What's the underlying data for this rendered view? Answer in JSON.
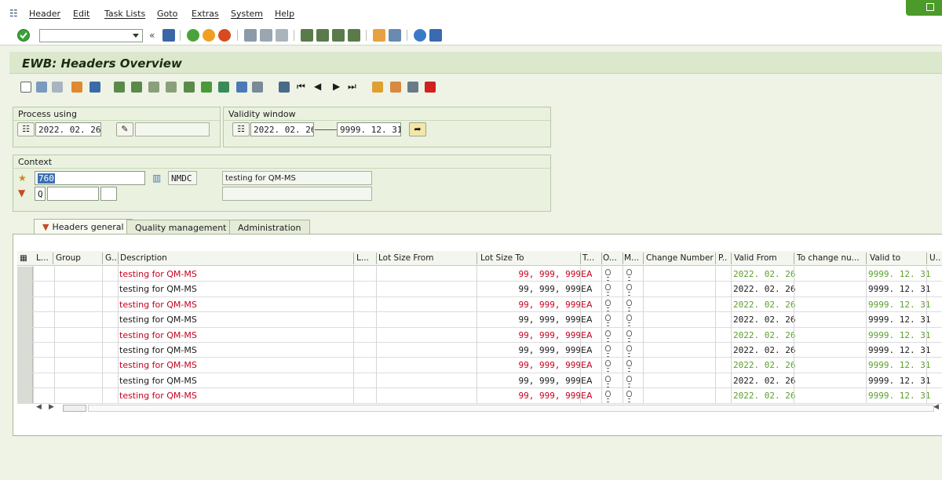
{
  "menu": {
    "items": [
      "Header",
      "Edit",
      "Task Lists",
      "Goto",
      "Extras",
      "System",
      "Help"
    ]
  },
  "title": "EWB: Headers Overview",
  "toolbar": {
    "history_glyph": "«"
  },
  "process_using": {
    "label": "Process using",
    "date": "2022. 02. 26"
  },
  "validity_window": {
    "label": "Validity window",
    "from": "2022. 02. 26",
    "to": "9999. 12. 31"
  },
  "context": {
    "label": "Context",
    "plant_code": "760",
    "plant_name": "NMDC",
    "description": "testing for QM-MS",
    "filter": "Q"
  },
  "tabs": [
    "Headers general",
    "Quality management",
    "Administration"
  ],
  "table": {
    "columns": [
      "L...",
      "Group",
      "G..",
      "Description",
      "L...",
      "Lot Size From",
      "Lot Size To",
      "T...",
      "O...",
      "M...",
      "Change Number",
      "P..",
      "Valid From",
      "To change nu...",
      "Valid to",
      "U.."
    ],
    "rows": [
      {
        "description": "testing for QM-MS",
        "lot_size_to": "99, 999, 999",
        "unit": "EA",
        "valid_from": "2022. 02. 26",
        "valid_to": "9999. 12. 31",
        "highlight": true
      },
      {
        "description": "testing for QM-MS",
        "lot_size_to": "99, 999, 999",
        "unit": "EA",
        "valid_from": "2022. 02. 26",
        "valid_to": "9999. 12. 31",
        "highlight": false
      },
      {
        "description": "testing for QM-MS",
        "lot_size_to": "99, 999, 999",
        "unit": "EA",
        "valid_from": "2022. 02. 26",
        "valid_to": "9999. 12. 31",
        "highlight": true
      },
      {
        "description": "testing for QM-MS",
        "lot_size_to": "99, 999, 999",
        "unit": "EA",
        "valid_from": "2022. 02. 26",
        "valid_to": "9999. 12. 31",
        "highlight": false
      },
      {
        "description": "testing for QM-MS",
        "lot_size_to": "99, 999, 999",
        "unit": "EA",
        "valid_from": "2022. 02. 26",
        "valid_to": "9999. 12. 31",
        "highlight": true
      },
      {
        "description": "testing for QM-MS",
        "lot_size_to": "99, 999, 999",
        "unit": "EA",
        "valid_from": "2022. 02. 26",
        "valid_to": "9999. 12. 31",
        "highlight": false
      },
      {
        "description": "testing for QM-MS",
        "lot_size_to": "99, 999, 999",
        "unit": "EA",
        "valid_from": "2022. 02. 26",
        "valid_to": "9999. 12. 31",
        "highlight": true
      },
      {
        "description": "testing for QM-MS",
        "lot_size_to": "99, 999, 999",
        "unit": "EA",
        "valid_from": "2022. 02. 26",
        "valid_to": "9999. 12. 31",
        "highlight": false
      },
      {
        "description": "testing for QM-MS",
        "lot_size_to": "99, 999, 999",
        "unit": "EA",
        "valid_from": "2022. 02. 26",
        "valid_to": "9999. 12. 31",
        "highlight": true
      }
    ]
  },
  "colors": {
    "highlight_text": "#c8001e",
    "date_green": "#5aa02c",
    "panel_bg": "#eaf1df"
  },
  "icons": {
    "toolbar": [
      "enter-icon",
      "back-icon",
      "exit-icon",
      "cancel-icon",
      "print-icon",
      "find-icon",
      "find-next-icon",
      "first-page-icon",
      "prev-page-icon",
      "next-page-icon",
      "last-page-icon",
      "create-session-icon",
      "shortcut-icon",
      "help-icon",
      "customize-icon"
    ],
    "app_toolbar": [
      "create-icon",
      "edit-icon",
      "display-icon",
      "copy-icon",
      "delete-icon",
      "select-all-icon",
      "deselect-icon",
      "sort-icon",
      "filter-icon",
      "details-icon",
      "layout-icon",
      "first-icon",
      "prev-icon",
      "next-icon",
      "last-icon",
      "hierarchy-icon",
      "settings-icon",
      "export-icon",
      "error-log-icon"
    ]
  }
}
